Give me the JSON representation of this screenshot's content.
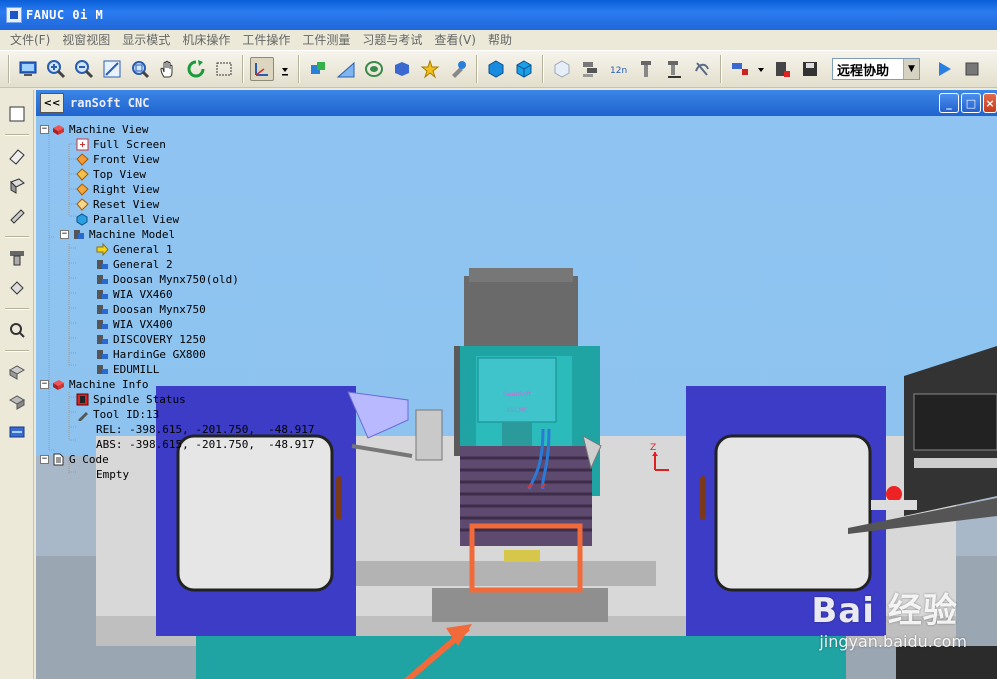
{
  "app": {
    "title": "FANUC 0i M"
  },
  "menu": [
    "文件(F)",
    "视窗视图",
    "显示模式",
    "机床操作",
    "工件操作",
    "工件测量",
    "习题与考试",
    "查看(V)",
    "帮助"
  ],
  "toolbar": {
    "mode_select": "远程协助",
    "icons": [
      "screen-icon",
      "zoom-in-icon",
      "zoom-out-icon",
      "zoom-window-icon",
      "zoom-fit-icon",
      "pan-hand-icon",
      "rotate-icon",
      "select-rect-icon",
      "axis-view-icon",
      "tool-icon",
      "measure-icon",
      "coolant-icon",
      "workpiece-icon",
      "star-icon",
      "wrench-icon",
      "cube-icon",
      "cube-alt-icon",
      "transparent-icon",
      "layers-icon",
      "dimension-icon",
      "probe-icon",
      "tool-length-icon",
      "clear-icon",
      "record-icon",
      "film-icon",
      "play-icon",
      "stop-icon"
    ]
  },
  "child_window": {
    "collapse_label": "<<",
    "title": "ranSoft CNC"
  },
  "tree": {
    "machine_view": {
      "label": "Machine View",
      "items": [
        "Full Screen",
        "Front View",
        "Top View",
        "Right View",
        "Reset View",
        "Parallel View"
      ]
    },
    "machine_model": {
      "label": "Machine Model",
      "items": [
        "General 1",
        "General 2",
        "Doosan Mynx750(old)",
        "WIA VX460",
        "Doosan Mynx750",
        "WIA VX400",
        "DISCOVERY 1250",
        "HardinGe GX800",
        "EDUMILL"
      ]
    },
    "machine_info": {
      "label": "Machine Info",
      "spindle_status": "Spindle Status",
      "tool_id": "Tool ID:13",
      "rel": "REL: -398.615, -201.750,  -48.917",
      "abs": "ABS: -398.615, -201.750,  -48.917"
    },
    "g_code": {
      "label": "G Code",
      "value": "Empty"
    }
  },
  "scene": {
    "spindle_head_label_1": "SwanSoft",
    "spindle_head_label_2": "SSCNC",
    "axis_z_label": "Z",
    "highlight_color": "#f06a3a"
  },
  "watermark": {
    "brand": "Bai  经验",
    "url": "jingyan.baidu.com"
  }
}
